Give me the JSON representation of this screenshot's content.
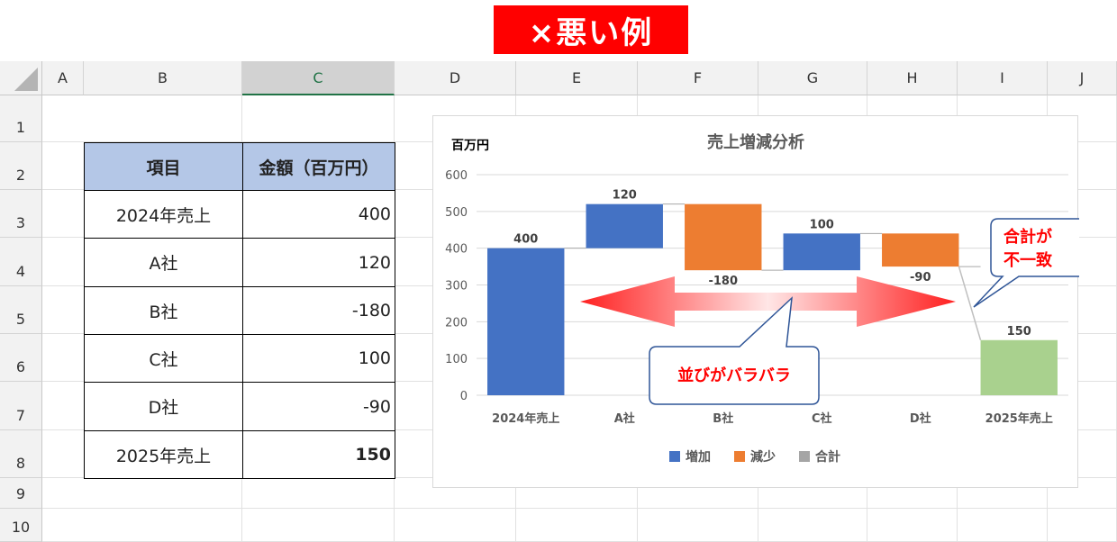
{
  "banner": {
    "text": "×悪い例",
    "color": "#ff0000"
  },
  "spreadsheet": {
    "columns": [
      "A",
      "B",
      "C",
      "D",
      "E",
      "F",
      "G",
      "H",
      "I",
      "J"
    ],
    "selected_column": "C",
    "rows": [
      "1",
      "2",
      "3",
      "4",
      "5",
      "6",
      "7",
      "8",
      "9",
      "10"
    ]
  },
  "table": {
    "headers": [
      "項目",
      "金額（百万円）"
    ],
    "rows": [
      {
        "label": "2024年売上",
        "value": "400",
        "bold": false
      },
      {
        "label": "A社",
        "value": "120",
        "bold": false
      },
      {
        "label": "B社",
        "value": "-180",
        "bold": false
      },
      {
        "label": "C社",
        "value": "100",
        "bold": false
      },
      {
        "label": "D社",
        "value": "-90",
        "bold": false
      },
      {
        "label": "2025年売上",
        "value": "150",
        "bold": true
      }
    ],
    "header_color": "#b4c7e7"
  },
  "chart_data": {
    "type": "bar",
    "subtype": "waterfall",
    "title": "売上増減分析",
    "unit_label": "百万円",
    "categories": [
      "2024年売上",
      "A社",
      "B社",
      "C社",
      "D社",
      "2025年売上"
    ],
    "bars": [
      {
        "base": 0,
        "top": 400,
        "label": "400",
        "kind": "total_blue"
      },
      {
        "base": 400,
        "top": 520,
        "label": "120",
        "kind": "increase"
      },
      {
        "base": 340,
        "top": 520,
        "label": "-180",
        "kind": "decrease"
      },
      {
        "base": 340,
        "top": 440,
        "label": "100",
        "kind": "increase"
      },
      {
        "base": 350,
        "top": 440,
        "label": "-90",
        "kind": "decrease"
      },
      {
        "base": 0,
        "top": 150,
        "label": "150",
        "kind": "total_green"
      }
    ],
    "ylim": [
      0,
      600
    ],
    "yticks": [
      "0",
      "100",
      "200",
      "300",
      "400",
      "500",
      "600"
    ],
    "grid": true,
    "legend": [
      {
        "name": "増加",
        "color": "#4472c4"
      },
      {
        "name": "減少",
        "color": "#ed7d31"
      },
      {
        "name": "合計",
        "color": "#a5a5a5"
      }
    ],
    "legend_position": "bottom",
    "colors": {
      "increase": "#4472c4",
      "decrease": "#ed7d31",
      "total_blue": "#4472c4",
      "total_green": "#a9d18e"
    }
  },
  "annotations": {
    "callout_total": "合計が\n不一致",
    "callout_total_line1": "合計が",
    "callout_total_line2": "不一致",
    "callout_order": "並びがバラバラ",
    "text_color": "#ff0000",
    "border_color": "#2f5597"
  }
}
